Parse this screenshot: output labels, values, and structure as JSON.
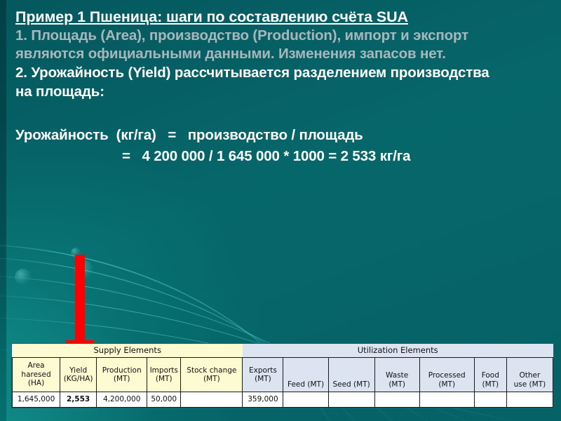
{
  "slide": {
    "background_color": "#056165",
    "title": "Пример 1 Пшеница: шаги по составлению счёта SUA",
    "body_lines": [
      {
        "text": "1. Площадь (Area), производство (Production), импорт и экспорт",
        "style": "dim"
      },
      {
        "text": "являются официальными данными.  Изменения запасов нет.",
        "style": "dim"
      },
      {
        "text": "2. Урожайность (Yield) рассчитывается разделением производства",
        "style": "bright"
      },
      {
        "text": "на площадь:",
        "style": "bright"
      }
    ],
    "formula_line_1": "Урожайность  (кг/га)   =   производство / площадь",
    "formula_line_2": "=   4 200 000 / 1 645 000 * 1000 = 2 533 кг/га",
    "arrow": {
      "name": "red-down-arrow",
      "color": "#ff0000",
      "points_to": "Yield (KG/HA) column"
    }
  },
  "table": {
    "group_headers": [
      {
        "label": "Supply Elements",
        "span": 5,
        "fill": "#fdfbd2"
      },
      {
        "label": "Utilization Elements",
        "span": 7,
        "fill": "#dce4f2"
      }
    ],
    "columns": [
      {
        "header": "Area haresed (HA)",
        "lines": [
          "Area",
          "haresed",
          "(HA)"
        ],
        "value": "1,645,000",
        "section": "supply"
      },
      {
        "header": "Yield (KG/HA)",
        "lines": [
          "Yield",
          "(KG/HA)"
        ],
        "value": "2,553",
        "section": "supply",
        "highlight": true
      },
      {
        "header": "Production (MT)",
        "lines": [
          "Production",
          "(MT)"
        ],
        "value": "4,200,000",
        "section": "supply"
      },
      {
        "header": "Imports (MT)",
        "lines": [
          "Imports",
          "(MT)"
        ],
        "value": "50,000",
        "section": "supply"
      },
      {
        "header": "Stock change (MT)",
        "lines": [
          "Stock change",
          "(MT)"
        ],
        "value": "",
        "section": "supply"
      },
      {
        "header": "Exports (MT)",
        "lines": [
          "Exports",
          "(MT)"
        ],
        "value": "359,000",
        "section": "utilization"
      },
      {
        "header": "Feed (MT)",
        "lines": [
          "Feed (MT)"
        ],
        "value": "",
        "section": "utilization"
      },
      {
        "header": "Seed (MT)",
        "lines": [
          "Seed (MT)"
        ],
        "value": "",
        "section": "utilization"
      },
      {
        "header": "Waste (MT)",
        "lines": [
          "Waste",
          "(MT)"
        ],
        "value": "",
        "section": "utilization"
      },
      {
        "header": "Processed (MT)",
        "lines": [
          "Processed",
          "(MT)"
        ],
        "value": "",
        "section": "utilization"
      },
      {
        "header": "Food (MT)",
        "lines": [
          "Food",
          "(MT)"
        ],
        "value": "",
        "section": "utilization"
      },
      {
        "header": "Other use (MT)",
        "lines": [
          "Other",
          "use (MT)"
        ],
        "value": "",
        "section": "utilization"
      }
    ],
    "yield_highlight_color": "#d0103a"
  }
}
